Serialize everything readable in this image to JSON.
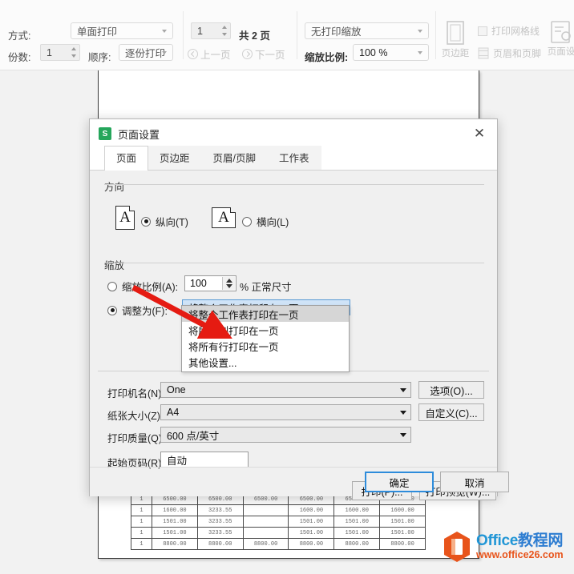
{
  "toolbar": {
    "mode_label": "方式:",
    "mode_value": "单面打印",
    "copies_label": "份数:",
    "copies_value": "1",
    "order_label": "顺序:",
    "order_value": "逐份打印",
    "page_value": "1",
    "page_total": "共 2 页",
    "prev_page": "上一页",
    "next_page": "下一页",
    "print_scale_value": "无打印缩放",
    "zoom_label": "缩放比例:",
    "zoom_value": "100 %",
    "margin_button": "页边距",
    "grid_checkbox": "打印网格线",
    "header_footer_checkbox": "页眉和页脚",
    "page_setup_button": "页面设"
  },
  "dialog": {
    "logo_glyph": "S",
    "title": "页面设置",
    "close_glyph": "✕",
    "tabs": [
      {
        "label": "页面",
        "active": true
      },
      {
        "label": "页边距",
        "active": false
      },
      {
        "label": "页眉/页脚",
        "active": false
      },
      {
        "label": "工作表",
        "active": false
      }
    ],
    "orientation": {
      "group_title": "方向",
      "portrait_label": "纵向(T)",
      "portrait_selected": true,
      "landscape_label": "横向(L)",
      "landscape_selected": false,
      "icon_glyph": "A"
    },
    "scaling": {
      "group_title": "缩放",
      "scale_radio_label": "缩放比例(A):",
      "scale_radio_selected": false,
      "scale_value": "100",
      "scale_suffix": "% 正常尺寸",
      "fit_radio_label": "调整为(F):",
      "fit_radio_selected": true,
      "fit_value": "将整个工作表打印在一页"
    },
    "dropdown_options": [
      {
        "label": "将整个工作表打印在一页",
        "selected": true
      },
      {
        "label": "将所有列打印在一页",
        "selected": false
      },
      {
        "label": "将所有行打印在一页",
        "selected": false
      },
      {
        "label": "其他设置...",
        "selected": false
      }
    ],
    "printer": {
      "name_label": "打印机名(N)",
      "name_value": "One",
      "options_button": "选项(O)...",
      "paper_label": "纸张大小(Z):",
      "paper_value": "A4",
      "custom_button": "自定义(C)...",
      "quality_label": "打印质量(Q):",
      "quality_value": "600 点/英寸",
      "start_page_label": "起始页码(R):",
      "start_page_value": "自动"
    },
    "actions": {
      "print": "打印(P)...",
      "preview": "打印预览(W)...",
      "ok": "确定",
      "cancel": "取消"
    }
  },
  "sheet": {
    "columns": 7,
    "rows": [
      [
        "1",
        "6500.00",
        "6500.00",
        "6500.00",
        "6500.00",
        "6500.00",
        "6500.00"
      ],
      [
        "1",
        "1600.00",
        "3233.55",
        "",
        "1600.00",
        "1600.00",
        "1600.00"
      ],
      [
        "1",
        "1501.00",
        "3233.55",
        "",
        "1501.00",
        "1501.00",
        "1501.00"
      ],
      [
        "1",
        "1501.00",
        "3233.55",
        "",
        "1501.00",
        "1501.00",
        "1501.00"
      ],
      [
        "1",
        "8800.00",
        "8800.00",
        "8800.00",
        "8800.00",
        "8800.00",
        "8800.00"
      ]
    ]
  },
  "watermark": {
    "brand_en": "Office",
    "brand_cn": "教程网",
    "url": "www.office26.com",
    "accent_color": "#e8541b",
    "brand_color": "#2196d6"
  }
}
